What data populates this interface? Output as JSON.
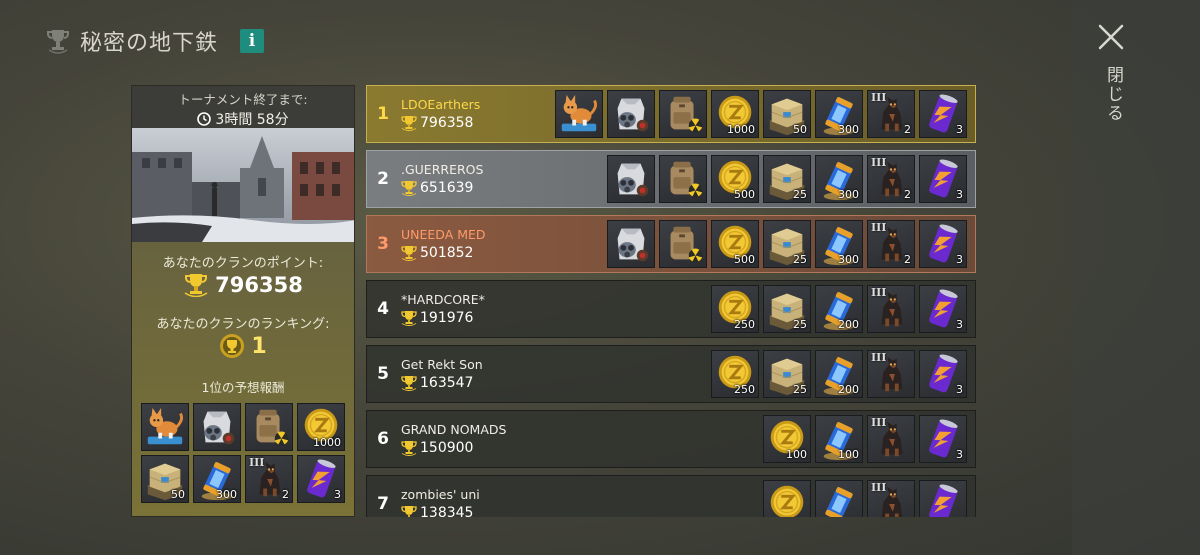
{
  "header": {
    "title": "秘密の地下鉄",
    "info_label": "i"
  },
  "close": {
    "label": "閉じる"
  },
  "tournament": {
    "timer_label": "トーナメント終了まで:",
    "timer_value": "3時間 58分",
    "points_label": "あなたのクランのポイント:",
    "points_value": "796358",
    "rank_label": "あなたのクランのランキング:",
    "rank_value": "1",
    "reward_label": "1位の予想報酬",
    "rewards": [
      {
        "icon": "cat-icon",
        "qty": ""
      },
      {
        "icon": "gasmask-vest-icon",
        "qty": ""
      },
      {
        "icon": "backpack-icon",
        "qty": ""
      },
      {
        "icon": "coin-icon",
        "qty": "1000"
      },
      {
        "icon": "supply-crate-icon",
        "qty": "50"
      },
      {
        "icon": "energy-canister-icon",
        "qty": "300"
      },
      {
        "icon": "dog-icon",
        "qty": "2",
        "tier": "III"
      },
      {
        "icon": "energy-can-icon",
        "qty": "3"
      }
    ]
  },
  "leaderboard": [
    {
      "rank": "1",
      "name": "LDOEarthers",
      "score": "796358",
      "style": "r1",
      "items": [
        {
          "icon": "cat-icon",
          "qty": ""
        },
        {
          "icon": "gasmask-vest-icon",
          "qty": ""
        },
        {
          "icon": "backpack-icon",
          "qty": ""
        },
        {
          "icon": "coin-icon",
          "qty": "1000"
        },
        {
          "icon": "supply-crate-icon",
          "qty": "50"
        },
        {
          "icon": "energy-canister-icon",
          "qty": "300"
        },
        {
          "icon": "dog-icon",
          "qty": "2",
          "tier": "III"
        },
        {
          "icon": "energy-can-icon",
          "qty": "3"
        }
      ]
    },
    {
      "rank": "2",
      "name": ".GUERREROS",
      "score": "651639",
      "style": "r2",
      "items": [
        {
          "icon": "gasmask-vest-icon",
          "qty": ""
        },
        {
          "icon": "backpack-icon",
          "qty": ""
        },
        {
          "icon": "coin-icon",
          "qty": "500"
        },
        {
          "icon": "supply-crate-icon",
          "qty": "25"
        },
        {
          "icon": "energy-canister-icon",
          "qty": "300"
        },
        {
          "icon": "dog-icon",
          "qty": "2",
          "tier": "III"
        },
        {
          "icon": "energy-can-icon",
          "qty": "3"
        }
      ]
    },
    {
      "rank": "3",
      "name": "UNEEDA MED",
      "score": "501852",
      "style": "r3",
      "items": [
        {
          "icon": "gasmask-vest-icon",
          "qty": ""
        },
        {
          "icon": "backpack-icon",
          "qty": ""
        },
        {
          "icon": "coin-icon",
          "qty": "500"
        },
        {
          "icon": "supply-crate-icon",
          "qty": "25"
        },
        {
          "icon": "energy-canister-icon",
          "qty": "300"
        },
        {
          "icon": "dog-icon",
          "qty": "2",
          "tier": "III"
        },
        {
          "icon": "energy-can-icon",
          "qty": "3"
        }
      ]
    },
    {
      "rank": "4",
      "name": "*HARDCORE*",
      "score": "191976",
      "style": "rn",
      "items": [
        {
          "icon": "coin-icon",
          "qty": "250"
        },
        {
          "icon": "supply-crate-icon",
          "qty": "25"
        },
        {
          "icon": "energy-canister-icon",
          "qty": "200"
        },
        {
          "icon": "dog-icon",
          "qty": "",
          "tier": "III"
        },
        {
          "icon": "energy-can-icon",
          "qty": "3"
        }
      ]
    },
    {
      "rank": "5",
      "name": "Get Rekt Son",
      "score": "163547",
      "style": "rn",
      "items": [
        {
          "icon": "coin-icon",
          "qty": "250"
        },
        {
          "icon": "supply-crate-icon",
          "qty": "25"
        },
        {
          "icon": "energy-canister-icon",
          "qty": "200"
        },
        {
          "icon": "dog-icon",
          "qty": "",
          "tier": "III"
        },
        {
          "icon": "energy-can-icon",
          "qty": "3"
        }
      ]
    },
    {
      "rank": "6",
      "name": "GRAND NOMADS",
      "score": "150900",
      "style": "rn",
      "items": [
        {
          "icon": "coin-icon",
          "qty": "100"
        },
        {
          "icon": "energy-canister-icon",
          "qty": "100"
        },
        {
          "icon": "dog-icon",
          "qty": "",
          "tier": "III"
        },
        {
          "icon": "energy-can-icon",
          "qty": "3"
        }
      ]
    },
    {
      "rank": "7",
      "name": "zombies' uni",
      "score": "138345",
      "style": "rn",
      "items": [
        {
          "icon": "coin-icon",
          "qty": ""
        },
        {
          "icon": "energy-canister-icon",
          "qty": ""
        },
        {
          "icon": "dog-icon",
          "qty": "",
          "tier": "III"
        },
        {
          "icon": "energy-can-icon",
          "qty": ""
        }
      ]
    }
  ]
}
